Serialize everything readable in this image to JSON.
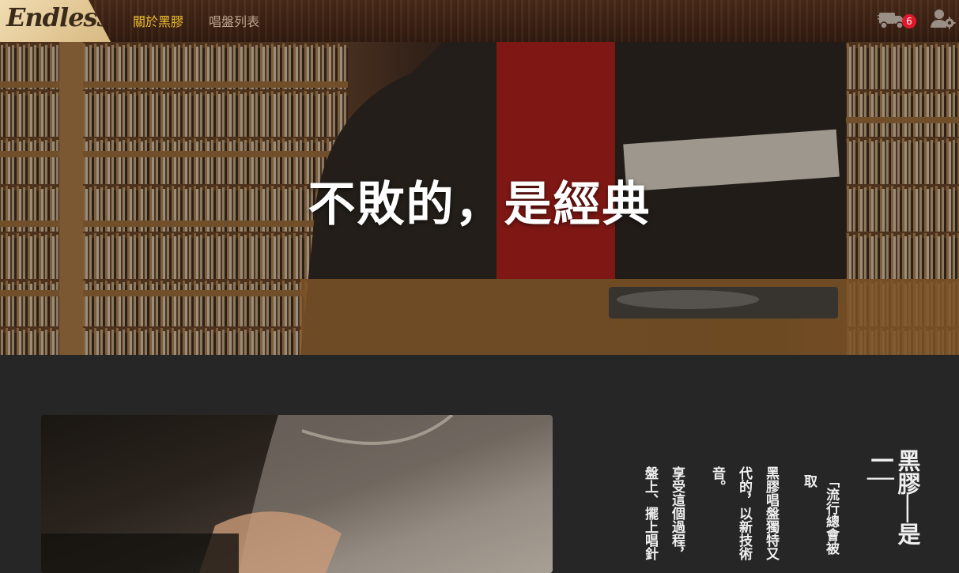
{
  "brand": {
    "logo_text": "Endless"
  },
  "nav": {
    "about_label": "關於黑膠",
    "list_label": "唱盤列表"
  },
  "header_actions": {
    "cart_count": "6"
  },
  "hero": {
    "title": "不敗的，是經典"
  },
  "content": {
    "heading": "黑膠──是一│",
    "quote": "「流行總會被取",
    "para1": "黑膠唱盤獨特又代的，以新技術音。",
    "para2": "享受這個過程，盤上、擺上唱針"
  },
  "colors": {
    "nav_active": "#f2c230",
    "nav_inactive": "#b9a58f",
    "badge": "#e0182c",
    "page_bg": "#262626"
  }
}
